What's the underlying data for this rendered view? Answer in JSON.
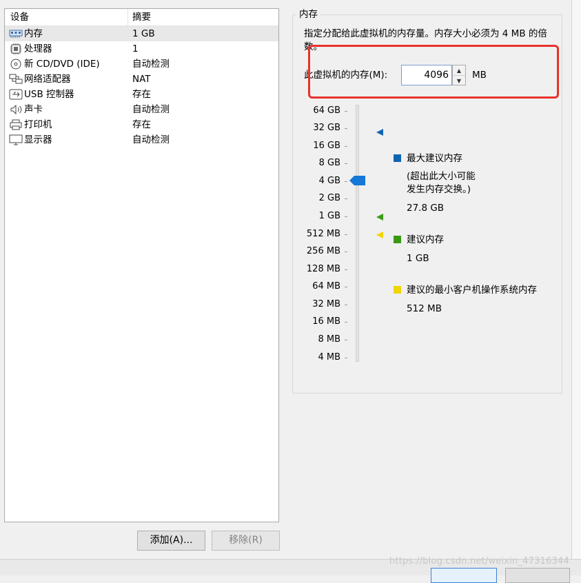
{
  "devices": {
    "header": {
      "device": "设备",
      "summary": "摘要"
    },
    "rows": [
      {
        "icon": "memory-icon",
        "name": "内存",
        "summary": "1 GB",
        "selected": true
      },
      {
        "icon": "processor-icon",
        "name": "处理器",
        "summary": "1"
      },
      {
        "icon": "cd-dvd-icon",
        "name": "新 CD/DVD (IDE)",
        "summary": "自动检测"
      },
      {
        "icon": "network-adapter-icon",
        "name": "网络适配器",
        "summary": "NAT"
      },
      {
        "icon": "usb-icon",
        "name": "USB 控制器",
        "summary": "存在"
      },
      {
        "icon": "sound-card-icon",
        "name": "声卡",
        "summary": "自动检测"
      },
      {
        "icon": "printer-icon",
        "name": "打印机",
        "summary": "存在"
      },
      {
        "icon": "display-icon",
        "name": "显示器",
        "summary": "自动检测"
      }
    ]
  },
  "buttons": {
    "add": "添加(A)...",
    "remove": "移除(R)"
  },
  "memory": {
    "legend": "内存",
    "description": "指定分配给此虚拟机的内存量。内存大小必须为 4 MB 的倍数。",
    "label": "此虚拟机的内存(M):",
    "value": "4096",
    "unit": "MB",
    "scale": [
      "64 GB",
      "32 GB",
      "16 GB",
      "8 GB",
      "4 GB",
      "2 GB",
      "1 GB",
      "512 MB",
      "256 MB",
      "128 MB",
      "64 MB",
      "32 MB",
      "16 MB",
      "8 MB",
      "4 MB"
    ],
    "slider_level": "4 GB",
    "legend_items": {
      "max": {
        "title": "最大建议内存",
        "note1": "(超出此大小可能",
        "note2": "发生内存交换。)",
        "value": "27.8 GB",
        "color": "#0f64b1"
      },
      "recommended": {
        "title": "建议内存",
        "value": "1 GB",
        "color": "#3a9a14"
      },
      "min_guest": {
        "title": "建议的最小客户机操作系统内存",
        "value": "512 MB",
        "color": "#f2d400"
      }
    },
    "colors": {
      "highlight": "#e8322b",
      "thumb": "#1677d6"
    }
  },
  "watermark": "https://blog.csdn.net/weixin_47316344"
}
